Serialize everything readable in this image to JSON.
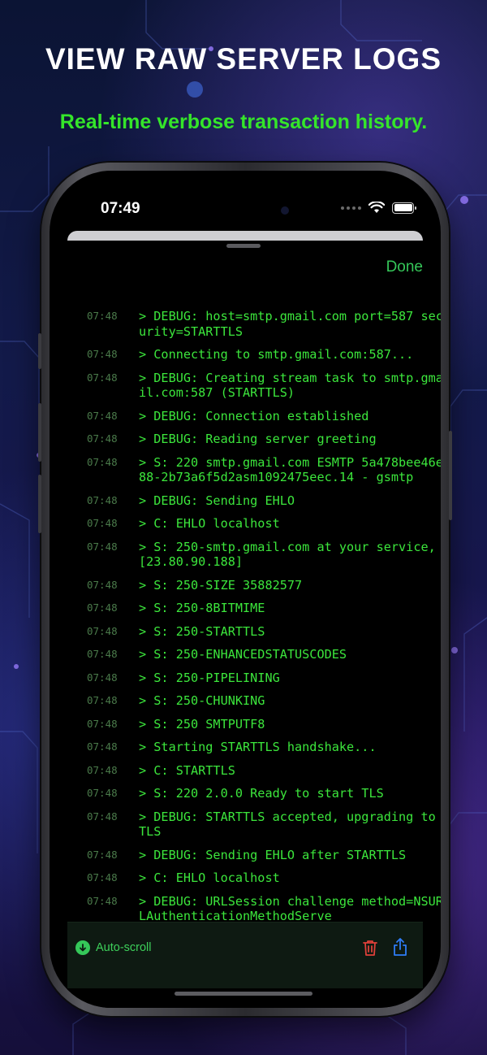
{
  "banner": {
    "title": "VIEW RAW SERVER LOGS",
    "subtitle": "Real-time verbose transaction history."
  },
  "status_bar": {
    "time": "07:49"
  },
  "sheet": {
    "done_label": "Done"
  },
  "log_entries": [
    {
      "time": "07:48",
      "text": "> DEBUG: host=smtp.gmail.com port=587 security=STARTTLS"
    },
    {
      "time": "07:48",
      "text": "> Connecting to smtp.gmail.com:587..."
    },
    {
      "time": "07:48",
      "text": "> DEBUG: Creating stream task to smtp.gmail.com:587 (STARTTLS)"
    },
    {
      "time": "07:48",
      "text": "> DEBUG: Connection established"
    },
    {
      "time": "07:48",
      "text": "> DEBUG: Reading server greeting"
    },
    {
      "time": "07:48",
      "text": "> S: 220 smtp.gmail.com ESMTP 5a478bee46e88-2b73a6f5d2asm1092475eec.14 - gsmtp"
    },
    {
      "time": "07:48",
      "text": "> DEBUG: Sending EHLO"
    },
    {
      "time": "07:48",
      "text": "> C: EHLO localhost"
    },
    {
      "time": "07:48",
      "text": "> S: 250-smtp.gmail.com at your service, [23.80.90.188]"
    },
    {
      "time": "07:48",
      "text": "> S: 250-SIZE 35882577"
    },
    {
      "time": "07:48",
      "text": "> S: 250-8BITMIME"
    },
    {
      "time": "07:48",
      "text": "> S: 250-STARTTLS"
    },
    {
      "time": "07:48",
      "text": "> S: 250-ENHANCEDSTATUSCODES"
    },
    {
      "time": "07:48",
      "text": "> S: 250-PIPELINING"
    },
    {
      "time": "07:48",
      "text": "> S: 250-CHUNKING"
    },
    {
      "time": "07:48",
      "text": "> S: 250 SMTPUTF8"
    },
    {
      "time": "07:48",
      "text": "> Starting STARTTLS handshake..."
    },
    {
      "time": "07:48",
      "text": "> C: STARTTLS"
    },
    {
      "time": "07:48",
      "text": "> S: 220 2.0.0 Ready to start TLS"
    },
    {
      "time": "07:48",
      "text": "> DEBUG: STARTTLS accepted, upgrading to TLS"
    },
    {
      "time": "07:48",
      "text": "> DEBUG: Sending EHLO after STARTTLS"
    },
    {
      "time": "07:48",
      "text": "> C: EHLO localhost"
    },
    {
      "time": "07:48",
      "text": "> DEBUG: URLSession challenge method=NSURLAuthenticationMethodServe"
    }
  ],
  "toolbar": {
    "auto_scroll_label": "Auto-scroll",
    "auto_scroll_icon": "arrow-down-circle-icon",
    "delete_icon": "trash-icon",
    "share_icon": "share-icon"
  },
  "colors": {
    "log_text": "#3ce63c",
    "accent_green": "#35c759",
    "delete_red": "#e0403a",
    "share_blue": "#2f7cf6"
  }
}
